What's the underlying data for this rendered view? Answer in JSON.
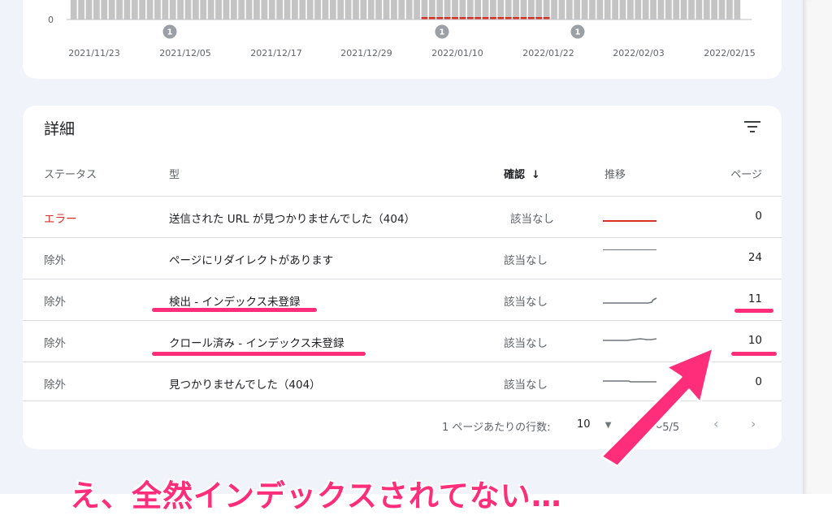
{
  "chart": {
    "y_zero_label": "0",
    "x_ticks": [
      "2021/11/23",
      "2021/12/05",
      "2021/12/17",
      "2021/12/29",
      "2022/01/10",
      "2022/01/22",
      "2022/02/03",
      "2022/02/15"
    ],
    "annotations": [
      "1",
      "1",
      "1"
    ],
    "colors": {
      "bar": "#c4c4c4",
      "highlight": "#d93025"
    }
  },
  "details": {
    "title": "詳細",
    "headers": {
      "status": "ステータス",
      "type": "型",
      "validation": "確認",
      "trend": "推移",
      "pages": "ページ"
    },
    "rows": [
      {
        "status": "エラー",
        "type": "送信された URL が見つかりませんでした（404）",
        "validation": "該当なし",
        "pages": "0"
      },
      {
        "status": "除外",
        "type": "ページにリダイレクトがあります",
        "validation": "該当なし",
        "pages": "24"
      },
      {
        "status": "除外",
        "type": "検出 - インデックス未登録",
        "validation": "該当なし",
        "pages": "11"
      },
      {
        "status": "除外",
        "type": "クロール済み - インデックス未登録",
        "validation": "該当なし",
        "pages": "10"
      },
      {
        "status": "除外",
        "type": "見つかりませんでした（404）",
        "validation": "該当なし",
        "pages": "0"
      }
    ],
    "pagination": {
      "rows_per_page_label": "1 ページあたりの行数:",
      "rows_per_page_value": "10",
      "range": "1〜5/5"
    },
    "colors": {
      "error": "#d93025",
      "neutral": "#5f6368"
    }
  },
  "annotation": {
    "caption": "え、全然インデックスされてない…",
    "color": "#ff2d7a"
  }
}
